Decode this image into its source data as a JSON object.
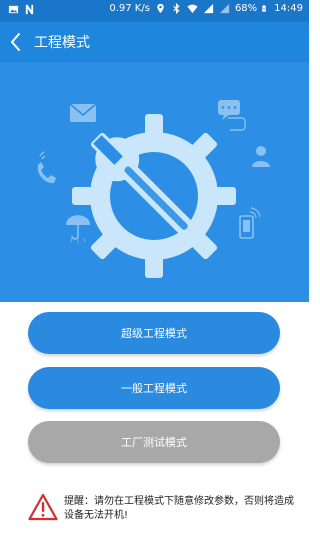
{
  "status_bar": {
    "speed": "0.97 K/s",
    "battery": "68%",
    "time": "14:49"
  },
  "header": {
    "title": "工程模式"
  },
  "buttons": {
    "super_mode": "超级工程模式",
    "normal_mode": "一般工程模式",
    "factory_test_mode": "工厂测试模式"
  },
  "warning": {
    "text": "提醒：请勿在工程模式下随意修改参数，否则将造成设备无法开机!"
  },
  "colors": {
    "status_bar": "#1976c9",
    "title_bar": "#1f86dd",
    "hero_background": "#2c8ee4",
    "primary_button": "#2a8ae0",
    "disabled_button": "#a8a8a8",
    "warning_red": "#d32f2f"
  },
  "icons": {
    "hero_main": "wrench-gear-icon",
    "decorations": [
      "mail-icon",
      "chat-icon",
      "phone-icon",
      "person-icon",
      "umbrella-icon",
      "mobile-icon"
    ]
  }
}
